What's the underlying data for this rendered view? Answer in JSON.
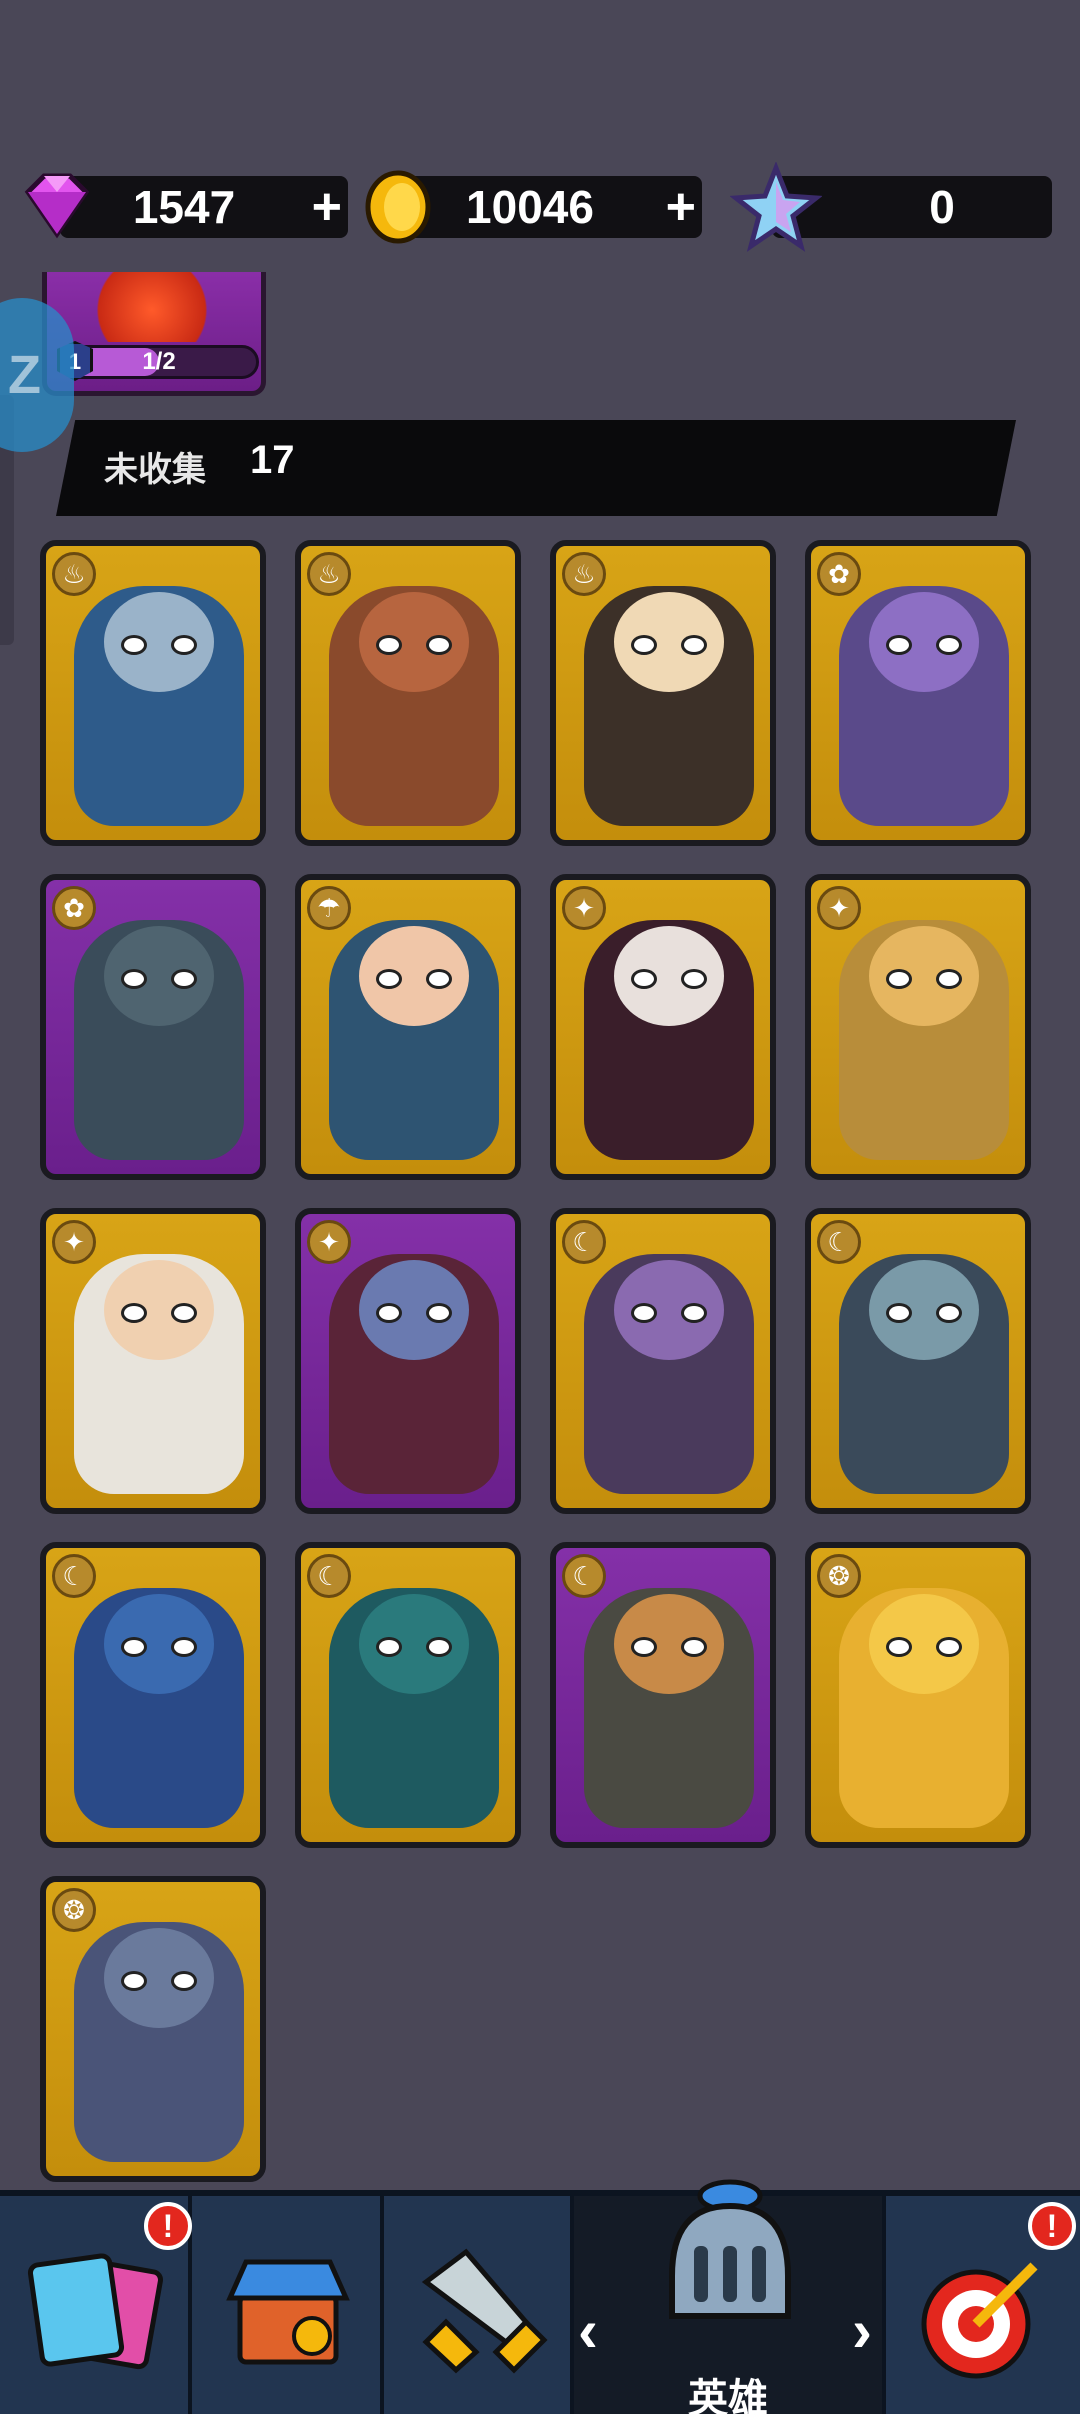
{
  "currencies": {
    "gems": {
      "value": "1547",
      "plus": "+",
      "icon": "gem-icon",
      "color": "#d93ee8"
    },
    "coins": {
      "value": "10046",
      "plus": "+",
      "icon": "coin-icon",
      "color": "#f5b80c"
    },
    "stars": {
      "value": "0",
      "icon": "star-icon",
      "color": "#7fc8f0"
    }
  },
  "partial_card": {
    "progress_text": "1/2",
    "level": "1",
    "progress": 0.5
  },
  "section": {
    "label": "未收集",
    "count": "17"
  },
  "heroes": [
    {
      "name": "hero-wolf-warrior",
      "frame": "gold",
      "class_icon": "fire-class-icon",
      "body": "#2e5b8a",
      "skin": "#9ab3c9"
    },
    {
      "name": "hero-minotaur",
      "frame": "gold",
      "class_icon": "fire-class-icon",
      "body": "#8a4a2c",
      "skin": "#b7653f"
    },
    {
      "name": "hero-samurai",
      "frame": "gold",
      "class_icon": "fire-class-icon",
      "body": "#3c3028",
      "skin": "#f0d9b5"
    },
    {
      "name": "hero-beast-rider",
      "frame": "gold",
      "class_icon": "nature-class-icon",
      "body": "#5a4a8a",
      "skin": "#8d6fc4"
    },
    {
      "name": "hero-dragon-knight",
      "frame": "purple",
      "class_icon": "nature-class-icon",
      "body": "#3a4c5a",
      "skin": "#4f6470"
    },
    {
      "name": "hero-sage",
      "frame": "gold",
      "class_icon": "water-class-icon",
      "body": "#2e5472",
      "skin": "#f0c6a8"
    },
    {
      "name": "hero-vampire",
      "frame": "gold",
      "class_icon": "light-class-icon",
      "body": "#3a1e2a",
      "skin": "#e8e0dc"
    },
    {
      "name": "hero-lion-king",
      "frame": "gold",
      "class_icon": "light-class-icon",
      "body": "#b88d3a",
      "skin": "#e6b660"
    },
    {
      "name": "hero-pharaoh",
      "frame": "gold",
      "class_icon": "light-class-icon",
      "body": "#e8e4dc",
      "skin": "#f0d0b0"
    },
    {
      "name": "hero-sorcerer",
      "frame": "purple",
      "class_icon": "light-class-icon",
      "body": "#5a2438",
      "skin": "#6a7ab0"
    },
    {
      "name": "hero-demon",
      "frame": "gold",
      "class_icon": "dark-class-icon",
      "body": "#4a3a5c",
      "skin": "#8a6ab0"
    },
    {
      "name": "hero-dark-knight",
      "frame": "gold",
      "class_icon": "dark-class-icon",
      "body": "#3a4a5a",
      "skin": "#7a9aa8"
    },
    {
      "name": "hero-cthulhu",
      "frame": "gold",
      "class_icon": "dark-class-icon",
      "body": "#2a4a88",
      "skin": "#3a6ab0"
    },
    {
      "name": "hero-shadow-wraith",
      "frame": "gold",
      "class_icon": "dark-class-icon",
      "body": "#1e5a60",
      "skin": "#2a7a7c"
    },
    {
      "name": "hero-dwarf-smith",
      "frame": "purple",
      "class_icon": "dark-class-icon",
      "body": "#4a4a42",
      "skin": "#c88a48"
    },
    {
      "name": "hero-honey-spirit",
      "frame": "gold",
      "class_icon": "spirit-class-icon",
      "body": "#e8b030",
      "skin": "#f4c848"
    },
    {
      "name": "hero-stone-golem",
      "frame": "gold",
      "class_icon": "spirit-class-icon",
      "body": "#4a5478",
      "skin": "#6a7a9c"
    }
  ],
  "nav": {
    "items": [
      {
        "name": "nav-cards",
        "icon": "cards-icon",
        "badge": "!"
      },
      {
        "name": "nav-shop",
        "icon": "shop-icon"
      },
      {
        "name": "nav-battle",
        "icon": "crossed-swords-icon"
      },
      {
        "name": "nav-heroes",
        "icon": "helmet-icon",
        "label": "英雄",
        "active": true
      },
      {
        "name": "nav-quests",
        "icon": "target-icon",
        "badge": "!"
      }
    ],
    "arrow_left": "‹",
    "arrow_right": "›"
  }
}
